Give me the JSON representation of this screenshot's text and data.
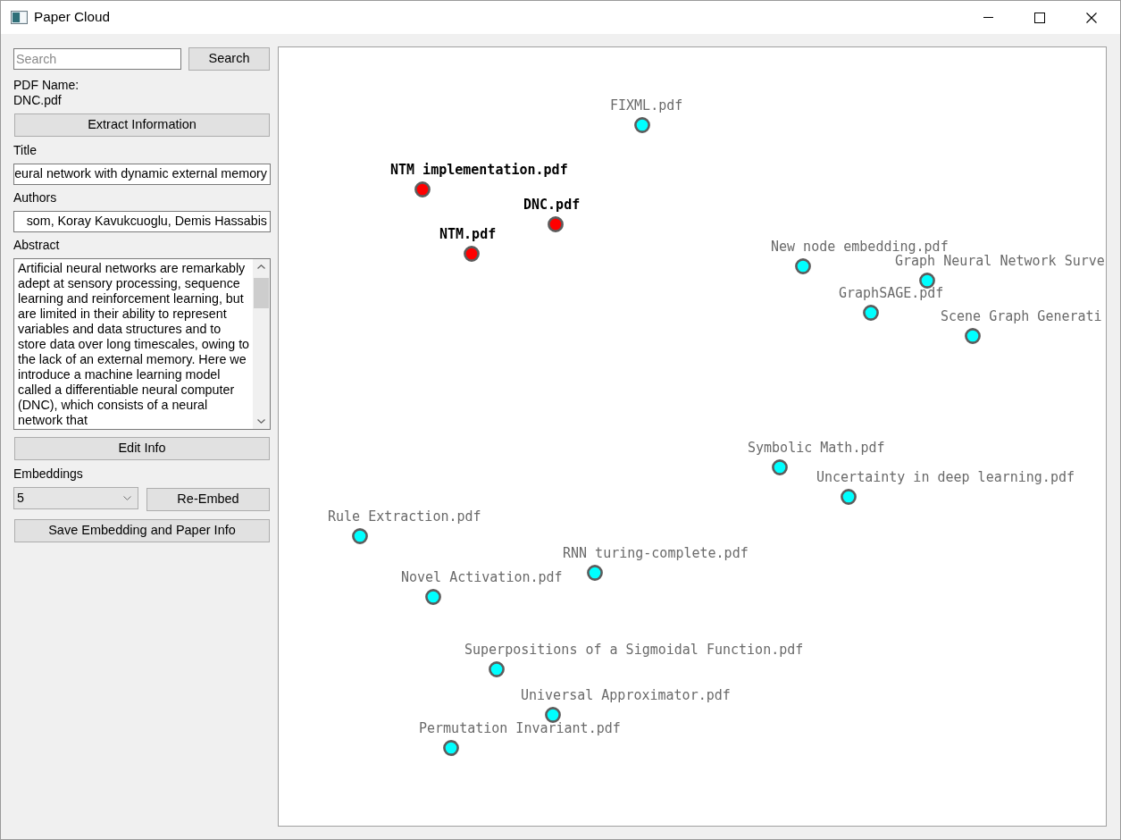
{
  "window": {
    "title": "Paper Cloud"
  },
  "sidebar": {
    "search": {
      "placeholder": "Search",
      "button": "Search"
    },
    "pdf_name_label": "PDF Name:",
    "pdf_name": "DNC.pdf",
    "extract_button": "Extract Information",
    "fields": [
      {
        "label": "Title",
        "value": "eural network with dynamic external memory"
      },
      {
        "label": "Authors",
        "value": "som, Koray Kavukcuoglu, Demis Hassabis"
      }
    ],
    "abstract": {
      "label": "Abstract",
      "value": "Artificial neural networks are remarkably adept at sensory processing, sequence learning and reinforcement learning, but are limited in their ability to represent variables and data structures and to store data over long timescales, owing to the lack of an external memory. Here we introduce a machine learning model called a differentiable neural computer (DNC), which consists of a neural network that"
    },
    "edit_button": "Edit Info",
    "embeddings": {
      "label": "Embeddings",
      "value": "5",
      "button": "Re-Embed"
    },
    "save_button": "Save Embedding and Paper Info"
  },
  "canvas": {
    "nodes": [
      {
        "label": "FIXML.pdf",
        "highlighted": false
      },
      {
        "label": "NTM implementation.pdf",
        "highlighted": true
      },
      {
        "label": "DNC.pdf",
        "highlighted": true
      },
      {
        "label": "NTM.pdf",
        "highlighted": true
      },
      {
        "label": "New node embedding.pdf",
        "highlighted": false
      },
      {
        "label": "Graph Neural Network Surve",
        "highlighted": false
      },
      {
        "label": "GraphSAGE.pdf",
        "highlighted": false
      },
      {
        "label": "Scene Graph Generati",
        "highlighted": false
      },
      {
        "label": "Symbolic Math.pdf",
        "highlighted": false
      },
      {
        "label": "Uncertainty in deep learning.pdf",
        "highlighted": false
      },
      {
        "label": "Rule Extraction.pdf",
        "highlighted": false
      },
      {
        "label": "RNN turing-complete.pdf",
        "highlighted": false
      },
      {
        "label": "Novel Activation.pdf",
        "highlighted": false
      },
      {
        "label": "Superpositions of a Sigmoidal Function.pdf",
        "highlighted": false
      },
      {
        "label": "Universal Approximator.pdf",
        "highlighted": false
      },
      {
        "label": "Permutation Invariant.pdf",
        "highlighted": false
      }
    ]
  }
}
